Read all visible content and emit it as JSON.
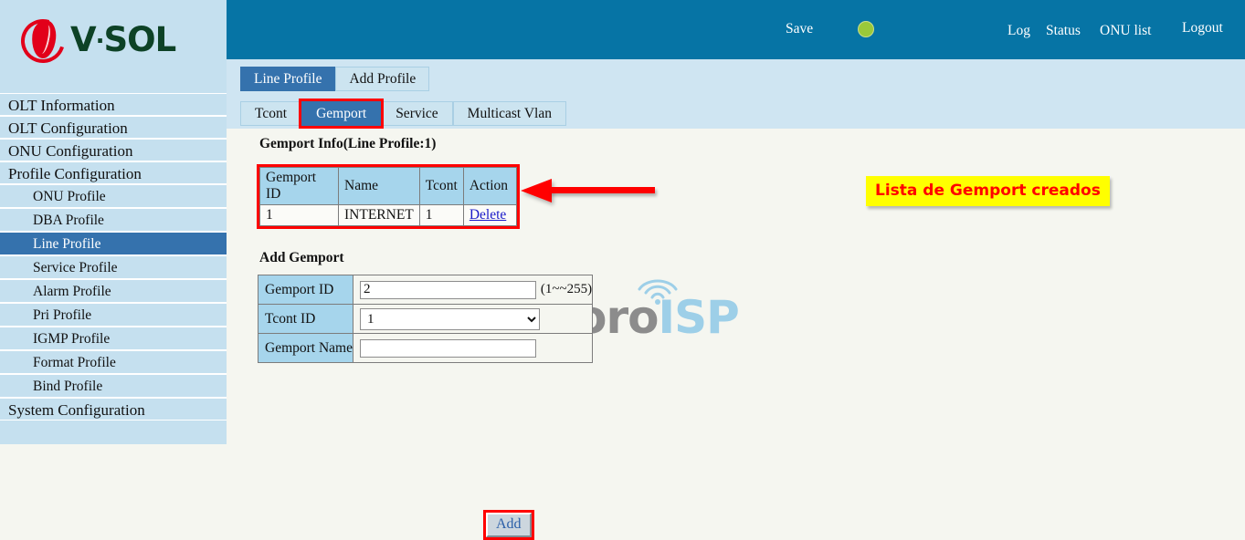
{
  "brand": {
    "logo_text_1": "V",
    "logo_dot": "·",
    "logo_text_2": "SOL"
  },
  "header": {
    "save_label": "Save",
    "status_dot_color": "#9ac93a",
    "log_label": "Log",
    "status_label": "Status",
    "onu_list_label": "ONU list",
    "logout_label": "Logout"
  },
  "sidebar": {
    "items": [
      {
        "label": "OLT Information",
        "level": "top",
        "active": false
      },
      {
        "label": "OLT Configuration",
        "level": "top",
        "active": false
      },
      {
        "label": "ONU Configuration",
        "level": "top",
        "active": false
      },
      {
        "label": "Profile Configuration",
        "level": "top",
        "active": false
      },
      {
        "label": "ONU Profile",
        "level": "sub",
        "active": false
      },
      {
        "label": "DBA Profile",
        "level": "sub",
        "active": false
      },
      {
        "label": "Line Profile",
        "level": "sub",
        "active": true
      },
      {
        "label": "Service Profile",
        "level": "sub",
        "active": false
      },
      {
        "label": "Alarm Profile",
        "level": "sub",
        "active": false
      },
      {
        "label": "Pri Profile",
        "level": "sub",
        "active": false
      },
      {
        "label": "IGMP Profile",
        "level": "sub",
        "active": false
      },
      {
        "label": "Format Profile",
        "level": "sub",
        "active": false
      },
      {
        "label": "Bind Profile",
        "level": "sub",
        "active": false
      },
      {
        "label": "System Configuration",
        "level": "top",
        "active": false
      }
    ]
  },
  "tabs_primary": [
    {
      "label": "Line Profile",
      "active": true
    },
    {
      "label": "Add Profile",
      "active": false
    }
  ],
  "tabs_secondary": [
    {
      "label": "Tcont",
      "active": false,
      "highlight": false
    },
    {
      "label": "Gemport",
      "active": true,
      "highlight": true
    },
    {
      "label": "Service",
      "active": false,
      "highlight": false
    },
    {
      "label": "Multicast Vlan",
      "active": false,
      "highlight": false
    }
  ],
  "gemport_info": {
    "title": "Gemport Info(Line Profile:1)",
    "columns": [
      "Gemport ID",
      "Name",
      "Tcont",
      "Action"
    ],
    "rows": [
      {
        "gemport_id": "1",
        "name": "INTERNET",
        "tcont": "1",
        "action": "Delete"
      }
    ],
    "highlight_color": "#ff0000"
  },
  "annotation": {
    "text": "Lista de Gemport creados",
    "box_color": "#ffff00",
    "text_color": "#ff0000",
    "arrow_color": "#ff0000"
  },
  "add_gemport": {
    "title": "Add Gemport",
    "fields": {
      "gemport_id_label": "Gemport ID",
      "gemport_id_value": "2",
      "gemport_id_hint": "(1~~255)",
      "tcont_id_label": "Tcont ID",
      "tcont_id_value": "1",
      "tcont_id_options": [
        "1"
      ],
      "gemport_name_label": "Gemport Name",
      "gemport_name_value": "",
      "gemport_name_placeholder": ""
    },
    "add_button_label": "Add",
    "add_button_highlight": "#ff0000"
  },
  "watermark": {
    "text_primary": "Foro",
    "text_secondary": "ISP",
    "color_primary": "#8c8c8c",
    "color_secondary": "#9dcfe8"
  }
}
